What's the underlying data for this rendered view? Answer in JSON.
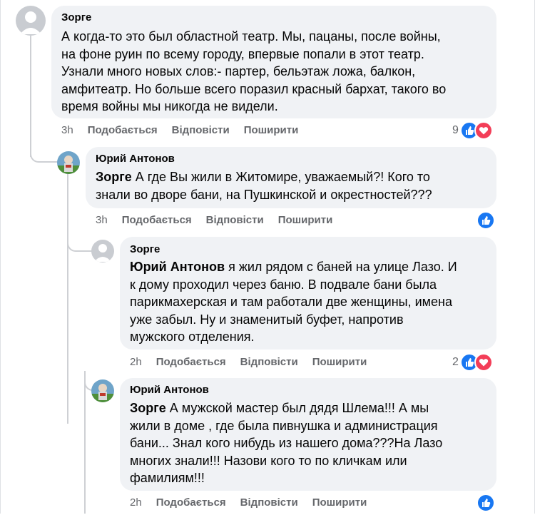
{
  "comments": [
    {
      "author": "Зорге",
      "mention": "",
      "text": "А когда-то это был областной театр. Мы, пацаны, после войны,\nна фоне руин по всему городу, впервые попали в этот театр.\nУзнали много новых слов:- партер, бельэтаж ложа, балкон,\nамфитеатр. Но больше всего поразил красный бархат, такого во\nвремя войны мы никогда не видели.",
      "time": "3h",
      "like": "Подобається",
      "reply": "Відповісти",
      "share": "Поширити",
      "reaction_count": "9",
      "reactions": [
        "like-icon",
        "love-icon"
      ]
    },
    {
      "author": "Юрий Антонов",
      "mention": "Зорге",
      "text": " А где Вы жили в Житомире, уважаемый?! Кого то\nзнали во дворе бани, на Пушкинской и окрестностей???",
      "time": "3h",
      "like": "Подобається",
      "reply": "Відповісти",
      "share": "Поширити",
      "reaction_count": "",
      "reactions": [
        "like-icon"
      ]
    },
    {
      "author": "Зорге",
      "mention": "Юрий Антонов",
      "text": " я жил рядом с баней на улице Лазо. И\nк дому проходил через баню. В подвале бани была\nпарикмахерская и там работали две женщины, имена\nуже забыл. Ну и знаменитый буфет, напротив\nмужского отделения.",
      "time": "2h",
      "like": "Подобається",
      "reply": "Відповісти",
      "share": "Поширити",
      "reaction_count": "2",
      "reactions": [
        "like-icon",
        "love-icon"
      ]
    },
    {
      "author": "Юрий Антонов",
      "mention": "Зорге",
      "text": " А мужской мастер был дядя Шлема!!! А мы\nжили в доме , где была пивнушка и администрация\nбани... Знал кого нибудь из нашего дома???На Лазо\nмногих знали!!! Назови кого то по кличкам или\nфамилиям!!!",
      "time": "2h",
      "like": "Подобається",
      "reply": "Відповісти",
      "share": "Поширити",
      "reaction_count": "",
      "reactions": [
        "like-icon"
      ]
    }
  ],
  "colors": {
    "bubble": "#f0f2f5",
    "like": "#1877f2",
    "love": "#f33e58",
    "meta": "#65676b"
  }
}
